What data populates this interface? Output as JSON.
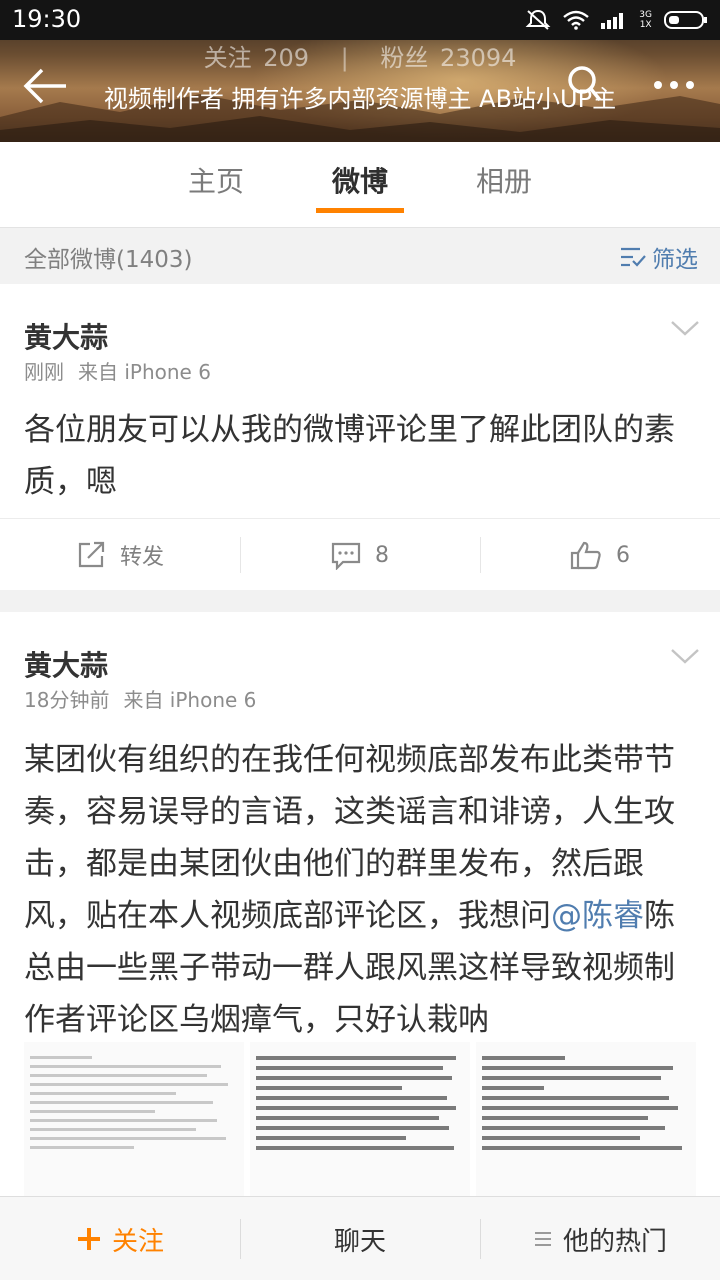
{
  "status_bar": {
    "time": "19:30",
    "network": [
      "3G",
      "1X"
    ]
  },
  "profile": {
    "following_label": "关注",
    "following_count": "209",
    "followers_label": "粉丝",
    "followers_count": "23094",
    "bio": "视频制作者 拥有许多内部资源博主 AB站小UP主"
  },
  "tabs": [
    {
      "label": "主页",
      "active": false
    },
    {
      "label": "微博",
      "active": true
    },
    {
      "label": "相册",
      "active": false
    }
  ],
  "filter_bar": {
    "title": "全部微博(1403)",
    "filter_label": "筛选"
  },
  "posts": [
    {
      "author": "黄大蒜",
      "time": "刚刚",
      "source": "来自 iPhone 6",
      "text": "各位朋友可以从我的微博评论里了解此团队的素质，嗯",
      "repost_label": "转发",
      "comments": "8",
      "likes": "6"
    },
    {
      "author": "黄大蒜",
      "time": "18分钟前",
      "source": "来自 iPhone 6",
      "text_before": "某团伙有组织的在我任何视频底部发布此类带节奏，容易误导的言语，这类谣言和诽谤，人生攻击，都是由某团伙由他们的群里发布，然后跟风，贴在本人视频底部评论区，我想问",
      "mention": "@陈睿",
      "text_after": "陈总由一些黑子带动一群人跟风黑这样导致视频制作者评论区乌烟瘴气，只好认栽呐"
    }
  ],
  "bottom_bar": {
    "follow": "关注",
    "chat": "聊天",
    "hot": "他的热门"
  },
  "colors": {
    "accent": "#ff8200",
    "link": "#507daf"
  }
}
